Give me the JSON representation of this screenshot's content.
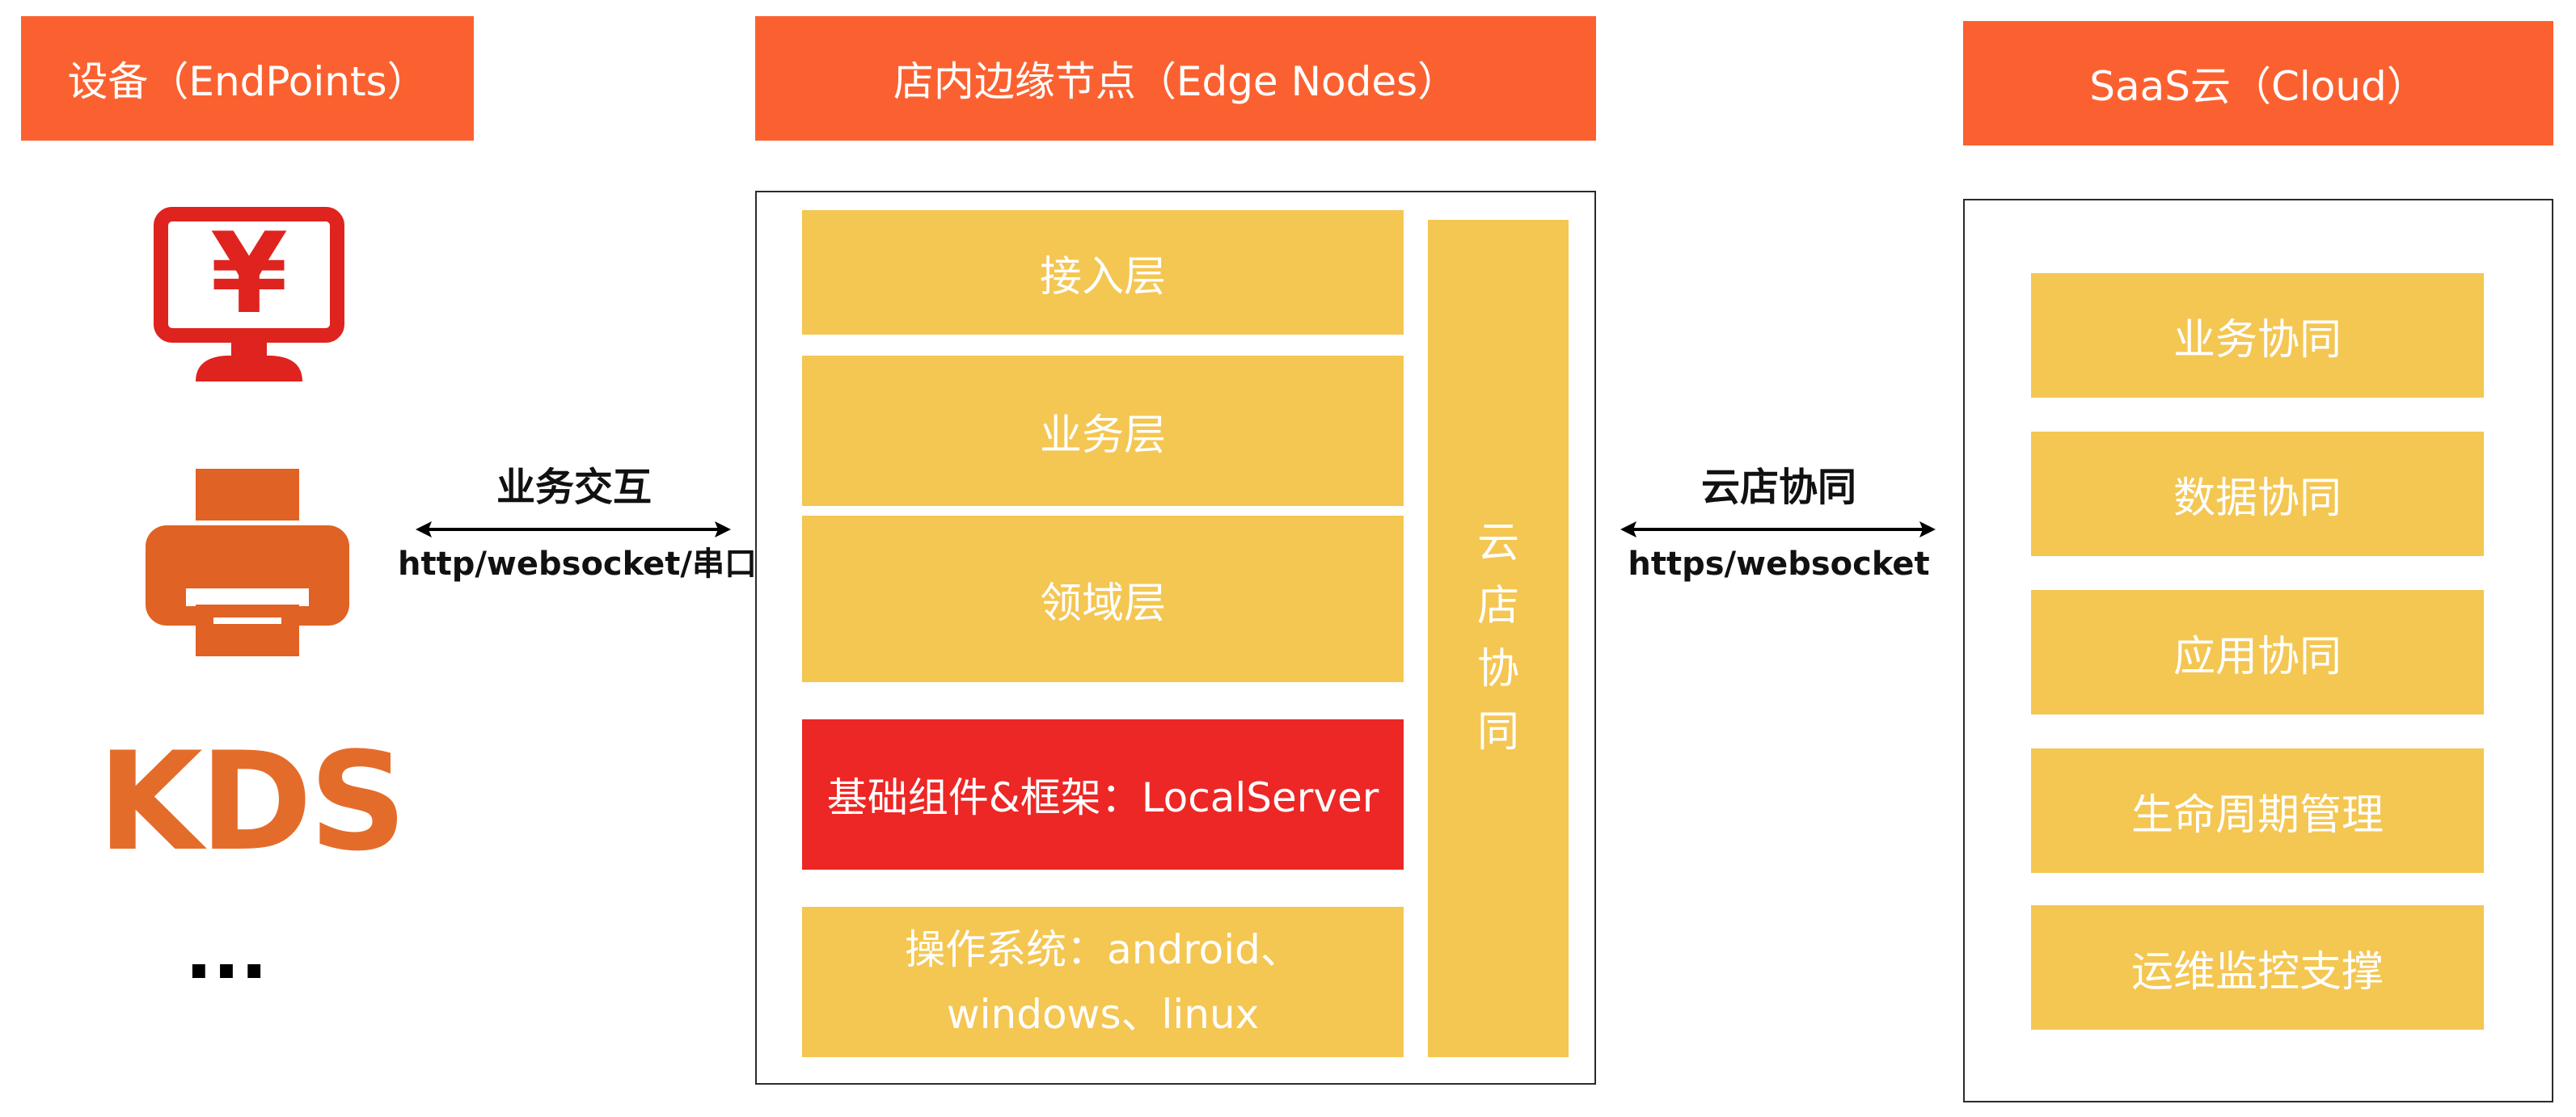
{
  "columns": {
    "devices": {
      "header": "设备（EndPoints）",
      "pos_symbol": "¥",
      "kds_label": "KDS",
      "ellipsis": "..."
    },
    "edge": {
      "header": "店内边缘节点（Edge Nodes）",
      "layers": [
        "接入层",
        "业务层",
        "领域层"
      ],
      "framework": "基础组件&框架：LocalServer",
      "os_line1": "操作系统：android、",
      "os_line2": "windows、linux",
      "cloud_sync_vertical": [
        "云",
        "店",
        "协",
        "同"
      ]
    },
    "cloud": {
      "header": "SaaS云（Cloud）",
      "items": [
        "业务协同",
        "数据协同",
        "应用协同",
        "生命周期管理",
        "运维监控支撑"
      ]
    }
  },
  "connectors": {
    "left": {
      "title": "业务交互",
      "protocol": "http/websocket/串口"
    },
    "right": {
      "title": "云店协同",
      "protocol": "https/websocket"
    }
  },
  "colors": {
    "header_orange": "#fb6130",
    "layer_yellow": "#f4c652",
    "framework_red": "#ec2725",
    "pos_red": "#df231e",
    "printer_orange": "#e06224",
    "kds_orange": "#e46c2a"
  }
}
